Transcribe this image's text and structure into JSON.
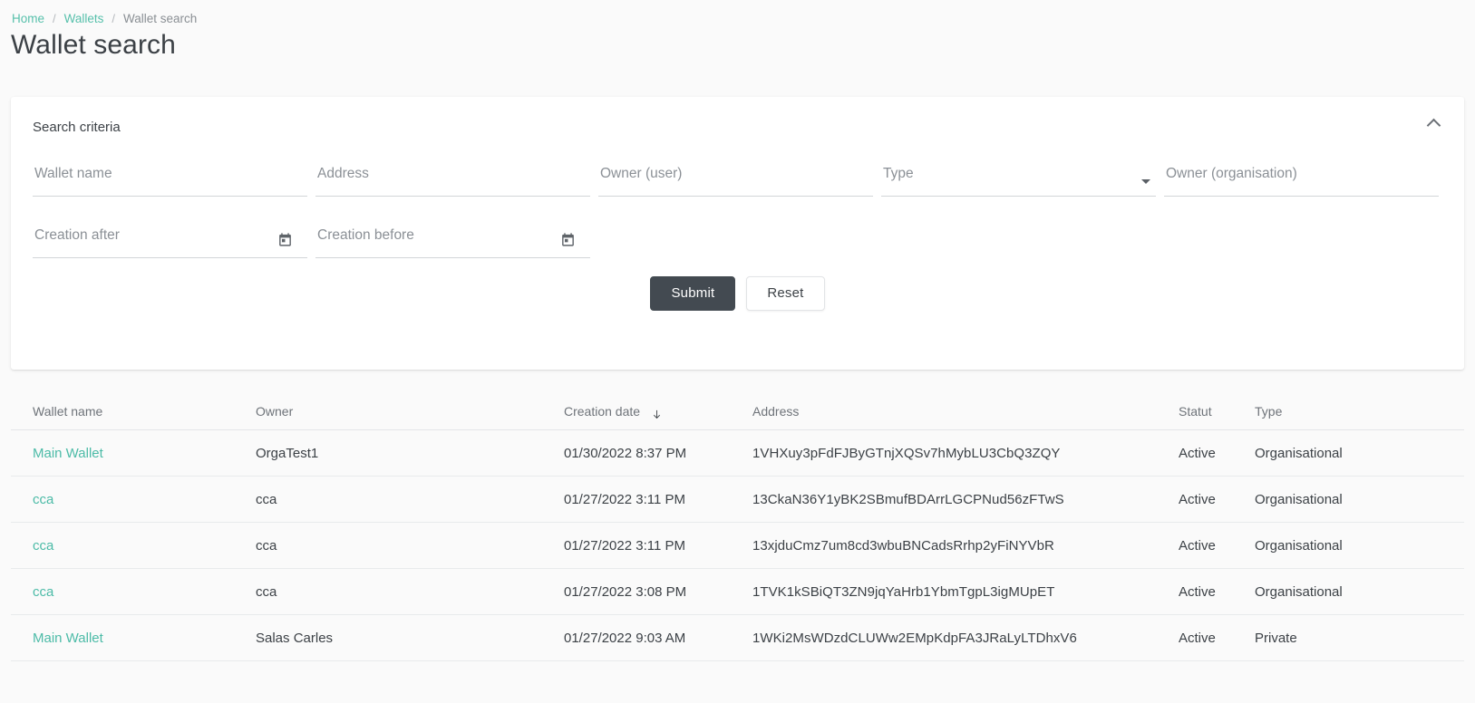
{
  "breadcrumb": {
    "items": [
      {
        "label": "Home",
        "type": "link"
      },
      {
        "label": "Wallets",
        "type": "link"
      },
      {
        "label": "Wallet search",
        "type": "current"
      }
    ],
    "separator": "/"
  },
  "page": {
    "title": "Wallet search"
  },
  "search_card": {
    "title": "Search criteria",
    "collapse_icon": "chevron-up-icon",
    "fields": [
      {
        "name": "wallet-name",
        "placeholder": "Wallet name",
        "value": "",
        "kind": "text"
      },
      {
        "name": "address",
        "placeholder": "Address",
        "value": "",
        "kind": "text"
      },
      {
        "name": "owner-user",
        "placeholder": "Owner (user)",
        "value": "",
        "kind": "text"
      },
      {
        "name": "type",
        "placeholder": "Type",
        "value": "",
        "kind": "select",
        "icon": "chevron-down-icon"
      },
      {
        "name": "owner-organisation",
        "placeholder": "Owner (organisation)",
        "value": "",
        "kind": "text"
      },
      {
        "name": "creation-after",
        "placeholder": "Creation after",
        "value": "",
        "kind": "date",
        "icon": "calendar-icon"
      },
      {
        "name": "creation-before",
        "placeholder": "Creation before",
        "value": "",
        "kind": "date",
        "icon": "calendar-icon"
      }
    ],
    "submit_label": "Submit",
    "reset_label": "Reset"
  },
  "results": {
    "columns": [
      {
        "key": "wallet_name",
        "label": "Wallet name"
      },
      {
        "key": "owner",
        "label": "Owner"
      },
      {
        "key": "creation_date",
        "label": "Creation date",
        "sort": "desc",
        "sort_icon": "arrow-down-icon"
      },
      {
        "key": "address",
        "label": "Address"
      },
      {
        "key": "status",
        "label": "Statut"
      },
      {
        "key": "type",
        "label": "Type"
      }
    ],
    "rows": [
      {
        "wallet_name": "Main Wallet",
        "owner": "OrgaTest1",
        "creation_date": "01/30/2022 8:37 PM",
        "address": "1VHXuy3pFdFJByGTnjXQSv7hMybLU3CbQ3ZQY",
        "status": "Active",
        "type": "Organisational"
      },
      {
        "wallet_name": "cca",
        "owner": "cca",
        "creation_date": "01/27/2022 3:11 PM",
        "address": "13CkaN36Y1yBK2SBmufBDArrLGCPNud56zFTwS",
        "status": "Active",
        "type": "Organisational"
      },
      {
        "wallet_name": "cca",
        "owner": "cca",
        "creation_date": "01/27/2022 3:11 PM",
        "address": "13xjduCmz7um8cd3wbuBNCadsRrhp2yFiNYVbR",
        "status": "Active",
        "type": "Organisational"
      },
      {
        "wallet_name": "cca",
        "owner": "cca",
        "creation_date": "01/27/2022 3:08 PM",
        "address": "1TVK1kSBiQT3ZN9jqYaHrb1YbmTgpL3igMUpET",
        "status": "Active",
        "type": "Organisational"
      },
      {
        "wallet_name": "Main Wallet",
        "owner": "Salas Carles",
        "creation_date": "01/27/2022 9:03 AM",
        "address": "1WKi2MsWDzdCLUWw2EMpKdpFA3JRaLyLTDhxV6",
        "status": "Active",
        "type": "Private"
      }
    ]
  },
  "colors": {
    "accent": "#4cbba7",
    "breadcrumb_link": "#57c0ab",
    "primary_button": "#434a51",
    "page_background": "#fafafa",
    "card_background": "#ffffff",
    "text": "#3c4146",
    "muted_text": "#6e7379"
  }
}
